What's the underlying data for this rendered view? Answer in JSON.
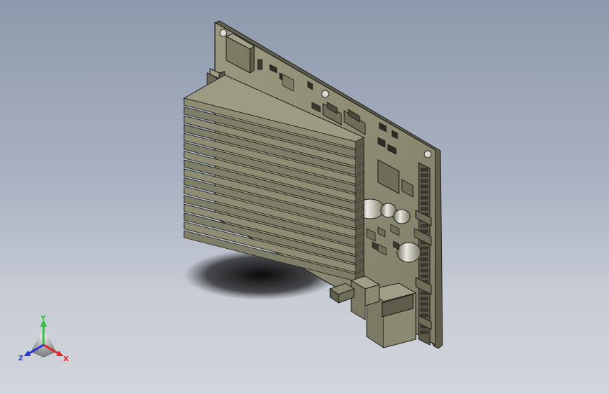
{
  "viewport": {
    "background_top": "#8e99ad",
    "background_bottom": "#d2d5da"
  },
  "model": {
    "board_color": "#8d8c73",
    "heatsink_color": "#8e8d74",
    "connector_color": "#7c7b64",
    "edge_color": "#1e1e1a"
  },
  "triad": {
    "x_label": "X",
    "y_label": "Y",
    "z_label": "Z",
    "x_color": "#e0262c",
    "y_color": "#2fc13f",
    "z_color": "#2633d8"
  }
}
